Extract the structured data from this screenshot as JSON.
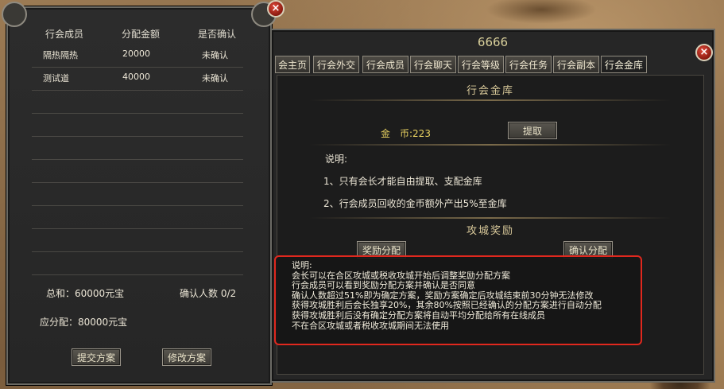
{
  "left_panel": {
    "columns": [
      "行会成员",
      "分配金额",
      "是否确认"
    ],
    "rows": [
      {
        "member": "隔热隔热",
        "amount": "20000",
        "status": "未确认"
      },
      {
        "member": "测试道",
        "amount": "40000",
        "status": "未确认"
      }
    ],
    "total": "总和：60000元宝",
    "confirm_count": "确认人数 0/2",
    "due": "应分配：80000元宝",
    "submit_button": "提交方案",
    "modify_button": "修改方案",
    "close_glyph": "×"
  },
  "right_panel": {
    "title": "6666",
    "tabs": [
      "会主页",
      "行会外交",
      "行会成员",
      "行会聊天",
      "行会等级",
      "行会任务",
      "行会副本",
      "行会金库"
    ],
    "active_tab": "行会金库",
    "treasury_title": "行会金库",
    "gold_label": "金　币:223",
    "withdraw_button": "提取",
    "notes_title": "说明:",
    "notes": [
      "1、只有会长才能自由提取、支配金库",
      "2、行会成员回收的金币额外产出5%至金库"
    ],
    "siege_title": "攻城奖励",
    "reward_button": "奖励分配",
    "confirm_button": "确认分配",
    "siege_notes": [
      "说明:",
      "会长可以在合区攻城或税收攻城开始后调整奖励分配方案",
      "行会成员可以看到奖励分配方案并确认是否同意",
      "确认人数超过51%即为确定方案，奖励方案确定后攻城结束前30分钟无法修改",
      "获得攻城胜利后会长独享20%，其余80%按照已经确认的分配方案进行自动分配",
      "获得攻城胜利后没有确定分配方案将自动平均分配给所有在线成员",
      "不在合区攻城或者税收攻城期间无法使用"
    ],
    "close_glyph": "×"
  },
  "colors": {
    "highlight_box": "#e0281e",
    "gold_text": "#e7d060"
  }
}
